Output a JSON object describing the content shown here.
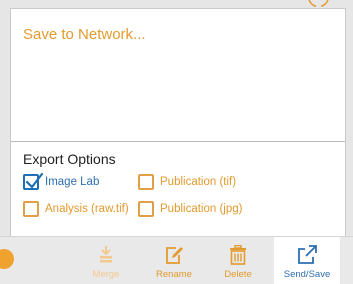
{
  "save_network": {
    "label": "Save to Network..."
  },
  "export_options": {
    "title": "Export Options",
    "options": [
      {
        "label": "Image Lab",
        "checked": true
      },
      {
        "label": "Publication (tif)",
        "checked": false
      },
      {
        "label": "Analysis (raw.tif)",
        "checked": false
      },
      {
        "label": "Publication (jpg)",
        "checked": false
      }
    ]
  },
  "toolbar": {
    "merge_label": "Merge",
    "rename_label": "Rename",
    "delete_label": "Delete",
    "send_save_label": "Send/Save",
    "icons": {
      "merge": "merge-icon",
      "rename": "rename-icon",
      "delete": "trash-icon",
      "send_save": "export-icon"
    }
  },
  "colors": {
    "accent_orange": "#e39a2e",
    "accent_blue": "#2d6fb0",
    "disabled_orange": "#f2c98e"
  }
}
